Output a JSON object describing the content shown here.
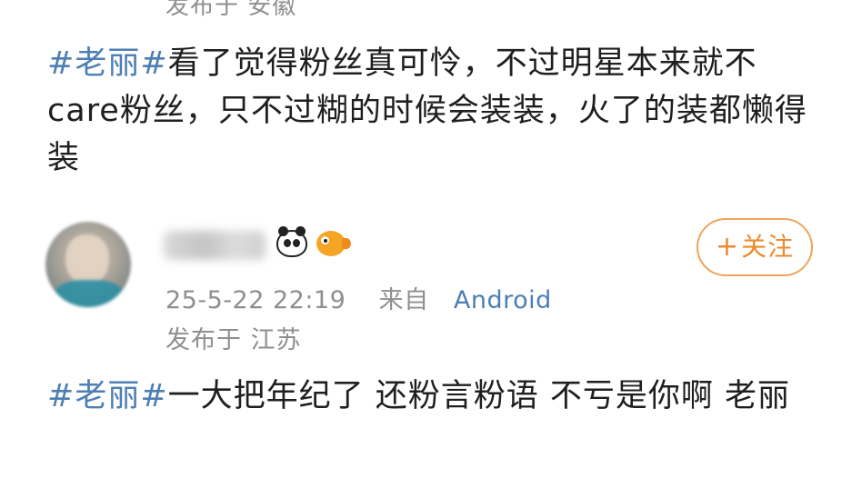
{
  "prev_comment": {
    "location": "发布于 安徽"
  },
  "post1": {
    "topic": "#老丽#",
    "text": "看了觉得粉丝真可怜，不过明星本来就不care粉丝，只不过糊的时候会装装，火了的装都懒得装"
  },
  "author": {
    "avatar": "blurred-user-avatar",
    "username": "（已打码）",
    "badges": [
      "panda-icon",
      "pufferfish-icon"
    ],
    "timestamp": "25-5-22 22:19",
    "source_prefix": "来自",
    "source": "Android",
    "location": "发布于 江苏"
  },
  "follow_button": {
    "plus": "+",
    "label": "关注"
  },
  "post2": {
    "topic": "#老丽#",
    "text": "一大把年纪了  还粉言粉语  不亏是你啊 老丽"
  },
  "colors": {
    "topic": "#4d7fb4",
    "meta": "#8f8f8f",
    "follow": "#ec8a2c"
  }
}
